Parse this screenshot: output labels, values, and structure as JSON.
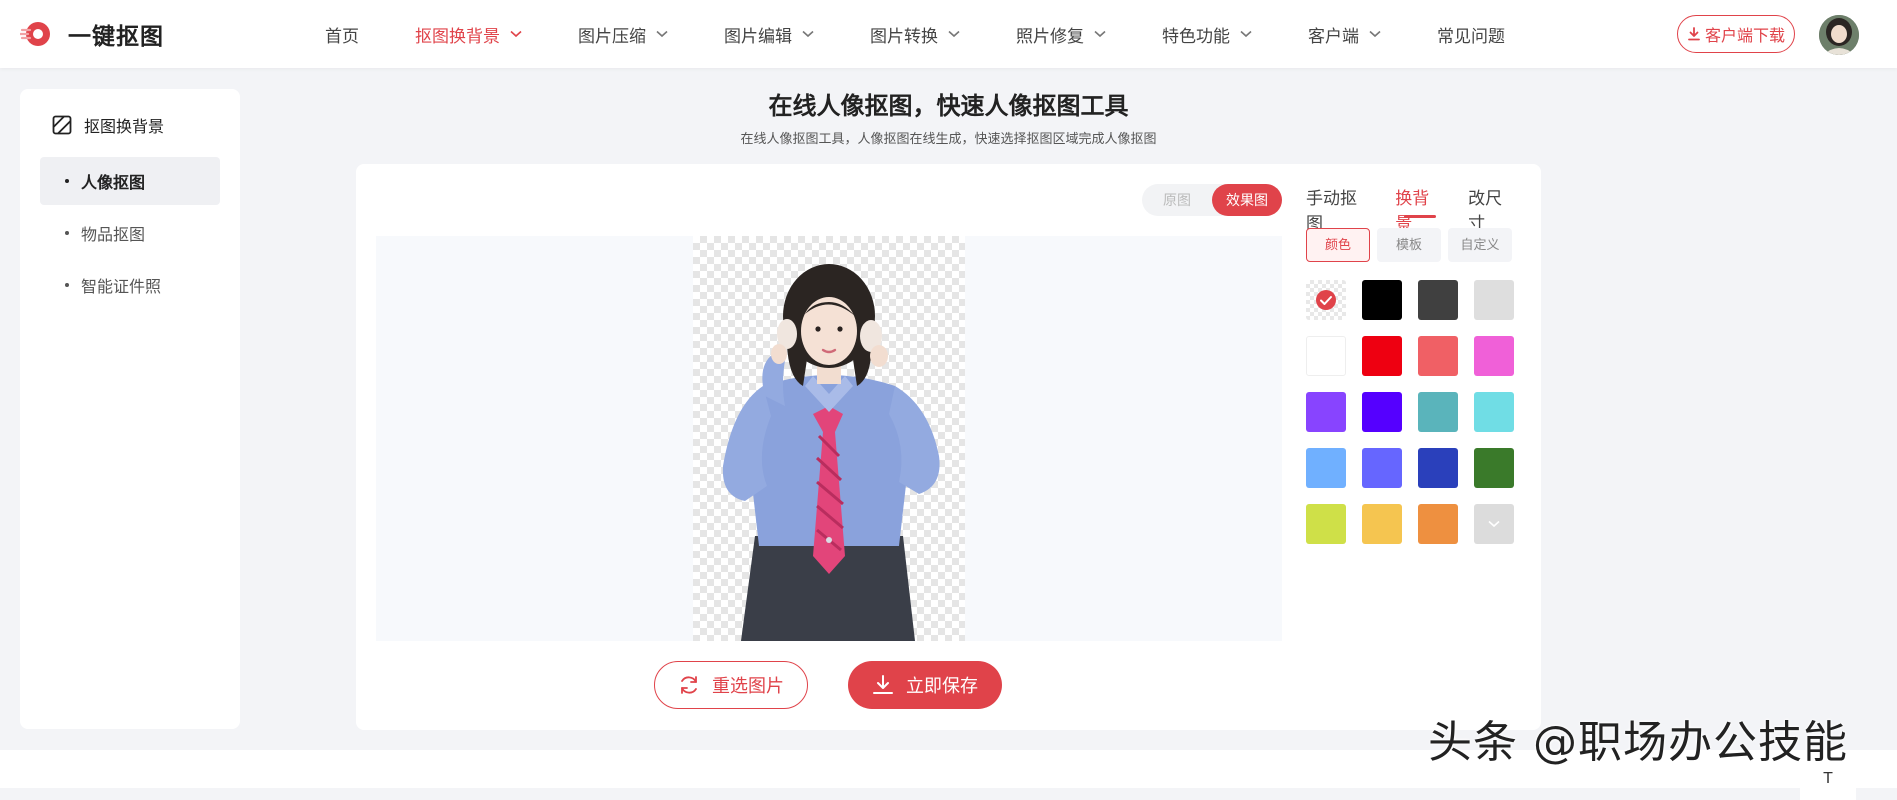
{
  "header": {
    "logo_text": "一键抠图",
    "nav": [
      {
        "label": "首页",
        "dropdown": false,
        "active": false
      },
      {
        "label": "抠图换背景",
        "dropdown": true,
        "active": true
      },
      {
        "label": "图片压缩",
        "dropdown": true,
        "active": false
      },
      {
        "label": "图片编辑",
        "dropdown": true,
        "active": false
      },
      {
        "label": "图片转换",
        "dropdown": true,
        "active": false
      },
      {
        "label": "照片修复",
        "dropdown": true,
        "active": false
      },
      {
        "label": "特色功能",
        "dropdown": true,
        "active": false
      },
      {
        "label": "客户端",
        "dropdown": true,
        "active": false
      },
      {
        "label": "常见问题",
        "dropdown": false,
        "active": false
      }
    ],
    "download_label": "客户端下载",
    "accent": "#e0434a"
  },
  "sidebar": {
    "title": "抠图换背景",
    "items": [
      {
        "label": "人像抠图",
        "active": true
      },
      {
        "label": "物品抠图",
        "active": false
      },
      {
        "label": "智能证件照",
        "active": false
      }
    ]
  },
  "main": {
    "title": "在线人像抠图，快速人像抠图工具",
    "subtitle": "在线人像抠图工具，人像抠图在线生成，快速选择抠图区域完成人像抠图",
    "view_toggle": {
      "original": "原图",
      "result": "效果图",
      "selected": "result"
    },
    "reselect_label": "重选图片",
    "save_label": "立即保存"
  },
  "panel": {
    "tabs": [
      {
        "label": "手动抠图",
        "active": false
      },
      {
        "label": "换背景",
        "active": true
      },
      {
        "label": "改尺寸",
        "active": false
      }
    ],
    "subtabs": [
      {
        "label": "颜色",
        "active": true
      },
      {
        "label": "模板",
        "active": false
      },
      {
        "label": "自定义",
        "active": false
      }
    ],
    "swatches": [
      "transparent",
      "#000000",
      "#404040",
      "#dedede",
      "#ffffff",
      "#ee0011",
      "#f06065",
      "#f060d8",
      "#8844ff",
      "#5500ff",
      "#5ab4bb",
      "#70dde5",
      "#70b0ff",
      "#6666ff",
      "#2a40bb",
      "#3a7a2a",
      "#cfe048",
      "#f5c550",
      "#ee9040",
      "more"
    ],
    "selected_swatch": 0
  },
  "watermark": "头条 @职场办公技能",
  "back_to_top": "T"
}
